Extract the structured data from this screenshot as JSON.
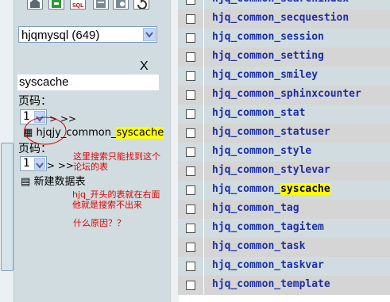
{
  "left": {
    "toolbar_icons": [
      "home-icon",
      "exit-icon",
      "sql-icon",
      "database-icon",
      "query-icon",
      "reload-icon"
    ],
    "database_select": {
      "value": "hjqmysql (649)"
    },
    "close_label": "X",
    "search": {
      "value": "syscache"
    },
    "page_label_1": "页码：",
    "page_select_1": "1",
    "page_nav_1": "> >>",
    "result_table": {
      "prefix": "hjqjy_common_",
      "highlight": "syscache"
    },
    "page_label_2": "页码：",
    "page_select_2": "1",
    "page_nav_2": "> >>",
    "new_table_label": "新建数据表"
  },
  "annotations": {
    "note1_line1": "这里搜索只能找到这个",
    "note1_line2": "论坛的表",
    "note2_line1": "hjq_开头的表就在右面",
    "note2_line2": "他就是搜索不出来",
    "note3": "什么原因？？"
  },
  "tables": [
    {
      "name": "hjq_common_searchindex",
      "highlight": ""
    },
    {
      "name": "hjq_common_secquestion",
      "highlight": ""
    },
    {
      "name": "hjq_common_session",
      "highlight": ""
    },
    {
      "name": "hjq_common_setting",
      "highlight": ""
    },
    {
      "name": "hjq_common_smiley",
      "highlight": ""
    },
    {
      "name": "hjq_common_sphinxcounter",
      "highlight": ""
    },
    {
      "name": "hjq_common_stat",
      "highlight": ""
    },
    {
      "name": "hjq_common_statuser",
      "highlight": ""
    },
    {
      "name": "hjq_common_style",
      "highlight": ""
    },
    {
      "name": "hjq_common_stylevar",
      "highlight": ""
    },
    {
      "name": "hjq_common_",
      "highlight": "syscache"
    },
    {
      "name": "hjq_common_tag",
      "highlight": ""
    },
    {
      "name": "hjq_common_tagitem",
      "highlight": ""
    },
    {
      "name": "hjq_common_task",
      "highlight": ""
    },
    {
      "name": "hjq_common_taskvar",
      "highlight": ""
    },
    {
      "name": "hjq_common_template",
      "highlight": ""
    }
  ],
  "colors": {
    "row_even": "#d0dce0",
    "row_odd": "#d5d5d5",
    "link": "#1d2fa8",
    "highlight": "#ffff00",
    "annotation": "#e00000"
  }
}
